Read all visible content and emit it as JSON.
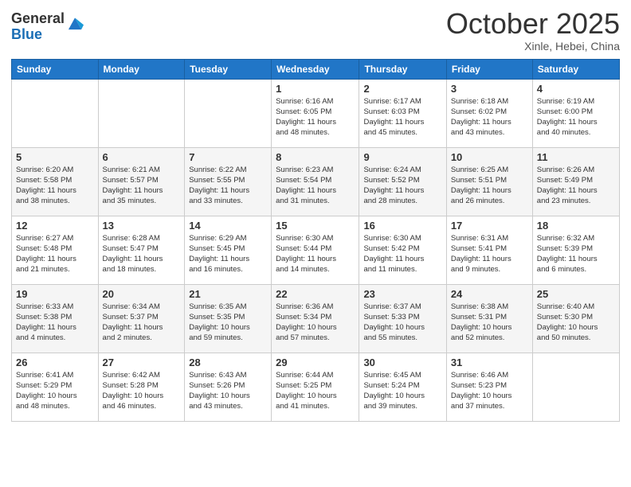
{
  "header": {
    "logo_general": "General",
    "logo_blue": "Blue",
    "month_title": "October 2025",
    "location": "Xinle, Hebei, China"
  },
  "days_of_week": [
    "Sunday",
    "Monday",
    "Tuesday",
    "Wednesday",
    "Thursday",
    "Friday",
    "Saturday"
  ],
  "weeks": [
    [
      {
        "day": "",
        "info": ""
      },
      {
        "day": "",
        "info": ""
      },
      {
        "day": "",
        "info": ""
      },
      {
        "day": "1",
        "info": "Sunrise: 6:16 AM\nSunset: 6:05 PM\nDaylight: 11 hours\nand 48 minutes."
      },
      {
        "day": "2",
        "info": "Sunrise: 6:17 AM\nSunset: 6:03 PM\nDaylight: 11 hours\nand 45 minutes."
      },
      {
        "day": "3",
        "info": "Sunrise: 6:18 AM\nSunset: 6:02 PM\nDaylight: 11 hours\nand 43 minutes."
      },
      {
        "day": "4",
        "info": "Sunrise: 6:19 AM\nSunset: 6:00 PM\nDaylight: 11 hours\nand 40 minutes."
      }
    ],
    [
      {
        "day": "5",
        "info": "Sunrise: 6:20 AM\nSunset: 5:58 PM\nDaylight: 11 hours\nand 38 minutes."
      },
      {
        "day": "6",
        "info": "Sunrise: 6:21 AM\nSunset: 5:57 PM\nDaylight: 11 hours\nand 35 minutes."
      },
      {
        "day": "7",
        "info": "Sunrise: 6:22 AM\nSunset: 5:55 PM\nDaylight: 11 hours\nand 33 minutes."
      },
      {
        "day": "8",
        "info": "Sunrise: 6:23 AM\nSunset: 5:54 PM\nDaylight: 11 hours\nand 31 minutes."
      },
      {
        "day": "9",
        "info": "Sunrise: 6:24 AM\nSunset: 5:52 PM\nDaylight: 11 hours\nand 28 minutes."
      },
      {
        "day": "10",
        "info": "Sunrise: 6:25 AM\nSunset: 5:51 PM\nDaylight: 11 hours\nand 26 minutes."
      },
      {
        "day": "11",
        "info": "Sunrise: 6:26 AM\nSunset: 5:49 PM\nDaylight: 11 hours\nand 23 minutes."
      }
    ],
    [
      {
        "day": "12",
        "info": "Sunrise: 6:27 AM\nSunset: 5:48 PM\nDaylight: 11 hours\nand 21 minutes."
      },
      {
        "day": "13",
        "info": "Sunrise: 6:28 AM\nSunset: 5:47 PM\nDaylight: 11 hours\nand 18 minutes."
      },
      {
        "day": "14",
        "info": "Sunrise: 6:29 AM\nSunset: 5:45 PM\nDaylight: 11 hours\nand 16 minutes."
      },
      {
        "day": "15",
        "info": "Sunrise: 6:30 AM\nSunset: 5:44 PM\nDaylight: 11 hours\nand 14 minutes."
      },
      {
        "day": "16",
        "info": "Sunrise: 6:30 AM\nSunset: 5:42 PM\nDaylight: 11 hours\nand 11 minutes."
      },
      {
        "day": "17",
        "info": "Sunrise: 6:31 AM\nSunset: 5:41 PM\nDaylight: 11 hours\nand 9 minutes."
      },
      {
        "day": "18",
        "info": "Sunrise: 6:32 AM\nSunset: 5:39 PM\nDaylight: 11 hours\nand 6 minutes."
      }
    ],
    [
      {
        "day": "19",
        "info": "Sunrise: 6:33 AM\nSunset: 5:38 PM\nDaylight: 11 hours\nand 4 minutes."
      },
      {
        "day": "20",
        "info": "Sunrise: 6:34 AM\nSunset: 5:37 PM\nDaylight: 11 hours\nand 2 minutes."
      },
      {
        "day": "21",
        "info": "Sunrise: 6:35 AM\nSunset: 5:35 PM\nDaylight: 10 hours\nand 59 minutes."
      },
      {
        "day": "22",
        "info": "Sunrise: 6:36 AM\nSunset: 5:34 PM\nDaylight: 10 hours\nand 57 minutes."
      },
      {
        "day": "23",
        "info": "Sunrise: 6:37 AM\nSunset: 5:33 PM\nDaylight: 10 hours\nand 55 minutes."
      },
      {
        "day": "24",
        "info": "Sunrise: 6:38 AM\nSunset: 5:31 PM\nDaylight: 10 hours\nand 52 minutes."
      },
      {
        "day": "25",
        "info": "Sunrise: 6:40 AM\nSunset: 5:30 PM\nDaylight: 10 hours\nand 50 minutes."
      }
    ],
    [
      {
        "day": "26",
        "info": "Sunrise: 6:41 AM\nSunset: 5:29 PM\nDaylight: 10 hours\nand 48 minutes."
      },
      {
        "day": "27",
        "info": "Sunrise: 6:42 AM\nSunset: 5:28 PM\nDaylight: 10 hours\nand 46 minutes."
      },
      {
        "day": "28",
        "info": "Sunrise: 6:43 AM\nSunset: 5:26 PM\nDaylight: 10 hours\nand 43 minutes."
      },
      {
        "day": "29",
        "info": "Sunrise: 6:44 AM\nSunset: 5:25 PM\nDaylight: 10 hours\nand 41 minutes."
      },
      {
        "day": "30",
        "info": "Sunrise: 6:45 AM\nSunset: 5:24 PM\nDaylight: 10 hours\nand 39 minutes."
      },
      {
        "day": "31",
        "info": "Sunrise: 6:46 AM\nSunset: 5:23 PM\nDaylight: 10 hours\nand 37 minutes."
      },
      {
        "day": "",
        "info": ""
      }
    ]
  ]
}
